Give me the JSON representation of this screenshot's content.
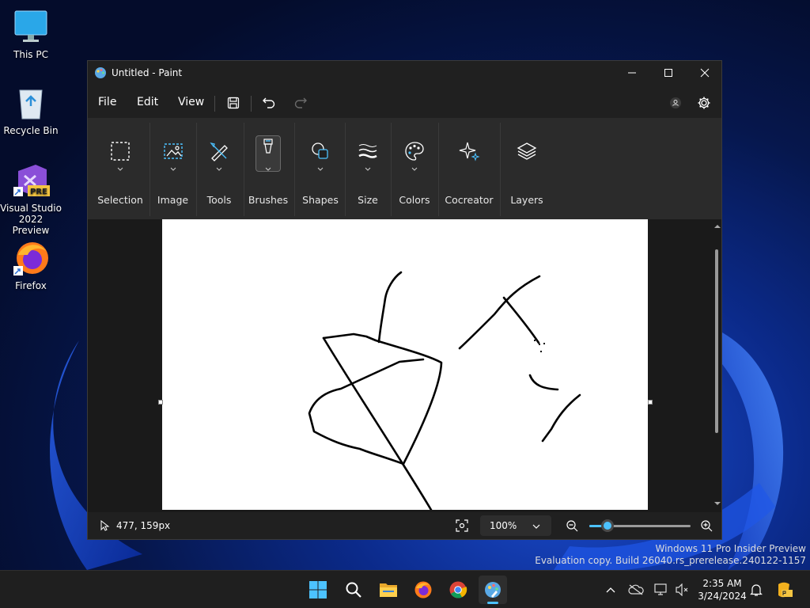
{
  "desktop": {
    "icons": [
      {
        "label": "This PC"
      },
      {
        "label": "Recycle Bin"
      },
      {
        "label": "Visual Studio 2022 Preview",
        "badge": "PRE"
      },
      {
        "label": "Firefox"
      }
    ]
  },
  "window": {
    "title": "Untitled - Paint",
    "menu": {
      "file": "File",
      "edit": "Edit",
      "view": "View"
    },
    "ribbon": [
      {
        "label": "Selection",
        "icon": "selection-icon"
      },
      {
        "label": "Image",
        "icon": "image-icon"
      },
      {
        "label": "Tools",
        "icon": "tools-icon"
      },
      {
        "label": "Brushes",
        "icon": "brush-icon"
      },
      {
        "label": "Shapes",
        "icon": "shapes-icon"
      },
      {
        "label": "Size",
        "icon": "size-icon"
      },
      {
        "label": "Colors",
        "icon": "palette-icon"
      },
      {
        "label": "Cocreator",
        "icon": "cocreator-icon"
      },
      {
        "label": "Layers",
        "icon": "layers-icon"
      }
    ],
    "status": {
      "coords": "477, 159px",
      "zoom": "100%",
      "zoom_level": 0.18
    }
  },
  "watermark": {
    "line1": "Windows 11 Pro Insider Preview",
    "line2": "Evaluation copy. Build 26040.rs_prerelease.240122-1157"
  },
  "taskbar": {
    "time": "2:35 AM",
    "date": "3/24/2024"
  },
  "colors": {
    "accent": "#4cc2ff",
    "window_bg": "#202020",
    "ribbon_bg": "#2b2b2b"
  }
}
